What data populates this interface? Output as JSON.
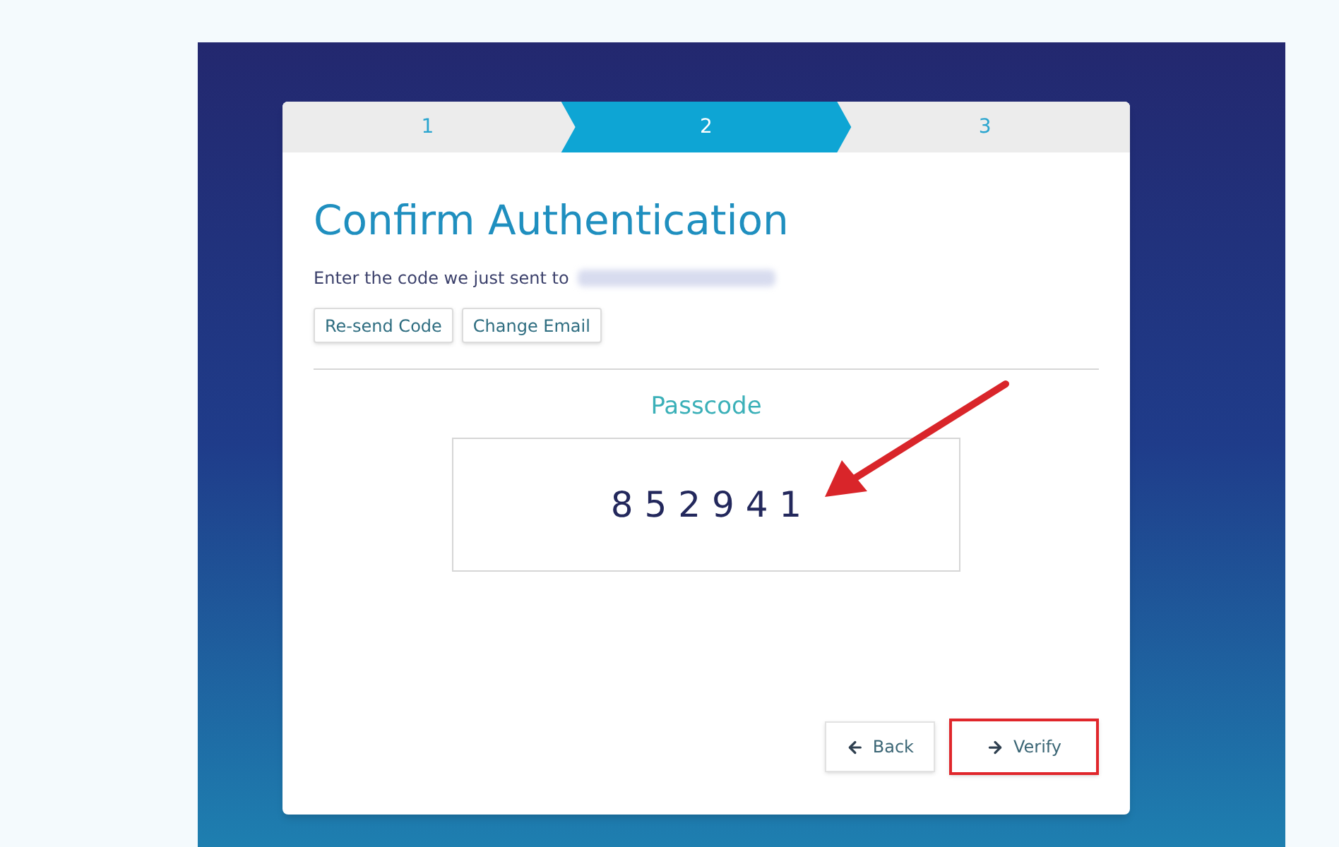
{
  "steps": [
    {
      "label": "1",
      "selected": false
    },
    {
      "label": "2",
      "selected": true
    },
    {
      "label": "3",
      "selected": false
    }
  ],
  "title": "Confirm Authentication",
  "instruction": "Enter the code we just sent to",
  "email_redacted": true,
  "actions": [
    "Re-send Code",
    "Change Email"
  ],
  "passcode": {
    "label": "Passcode",
    "value": "8 5 2 9 4 1"
  },
  "buttons": [
    {
      "kind": "back",
      "label": "Back",
      "highlighted": false
    },
    {
      "kind": "forward",
      "label": "Verify",
      "highlighted": true
    }
  ]
}
